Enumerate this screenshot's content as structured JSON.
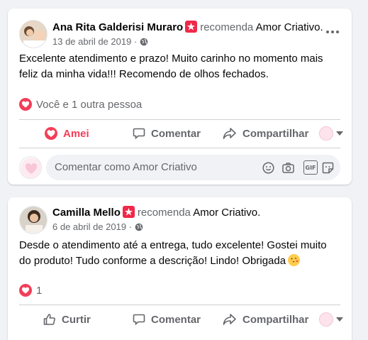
{
  "posts": [
    {
      "author": "Ana Rita Galderisi Muraro",
      "recommends_text": "recomenda",
      "page_name": "Amor Criativo",
      "page_suffix": ".",
      "date": "13 de abril de 2019",
      "date_sep": "·",
      "text": "Excelente atendimento e prazo! Muito carinho no momento mais feliz da minha vida!!! Recomendo de olhos fechados.",
      "reactions": "Você e 1 outra pessoa",
      "actions": {
        "react": "Amei",
        "comment": "Comentar",
        "share": "Compartilhar"
      },
      "comment_placeholder": "Comentar como Amor Criativo"
    },
    {
      "author": "Camilla Mello",
      "recommends_text": "recomenda",
      "page_name": "Amor Criativo",
      "page_suffix": ".",
      "date": "6 de abril de 2019",
      "date_sep": "·",
      "text": "Desde o atendimento até a entrega, tudo excelente! Gostei muito do produto! Tudo conforme a descrição! Lindo! Obrigada",
      "reactions": "1",
      "actions": {
        "react": "Curtir",
        "comment": "Comentar",
        "share": "Compartilhar"
      }
    }
  ],
  "colors": {
    "love": "#f33e58",
    "badge": "#f02849",
    "muted": "#65676b",
    "background": "#f0f2f5"
  },
  "icons": [
    "recommend-badge-icon",
    "globe-icon",
    "more-icon",
    "heart-reaction-icon",
    "like-icon",
    "comment-icon",
    "share-icon",
    "emoji-icon",
    "camera-icon",
    "gif-icon",
    "sticker-icon"
  ]
}
